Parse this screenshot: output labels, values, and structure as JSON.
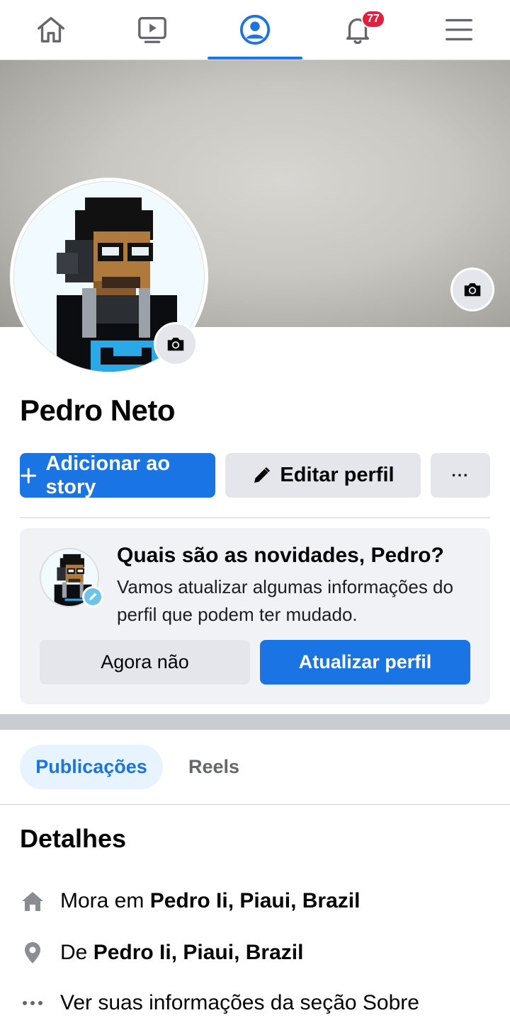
{
  "nav": {
    "items": [
      "home",
      "watch",
      "profile",
      "notifications",
      "menu"
    ],
    "notifications_badge": "77",
    "active": "profile"
  },
  "profile": {
    "name": "Pedro Neto"
  },
  "actions": {
    "add_story_label": "Adicionar ao story",
    "edit_profile_label": "Editar perfil",
    "more_label": "···"
  },
  "update_card": {
    "title": "Quais são as novidades, Pedro?",
    "text": "Vamos atualizar algumas informações do perfil que podem ter mudado.",
    "dismiss_label": "Agora não",
    "update_label": "Atualizar perfil"
  },
  "tabs": [
    {
      "label": "Publicações",
      "active": true
    },
    {
      "label": "Reels",
      "active": false
    }
  ],
  "details": {
    "title": "Detalhes",
    "lives_prefix": "Mora em ",
    "lives_value": "Pedro Ii, Piaui, Brazil",
    "from_prefix": "De ",
    "from_value": "Pedro Ii, Piaui, Brazil",
    "about_link": "Ver suas informações da seção Sobre"
  },
  "colors": {
    "accent": "#1b74e4",
    "badge": "#e41e3f",
    "card_bg": "#f0f2f5"
  }
}
